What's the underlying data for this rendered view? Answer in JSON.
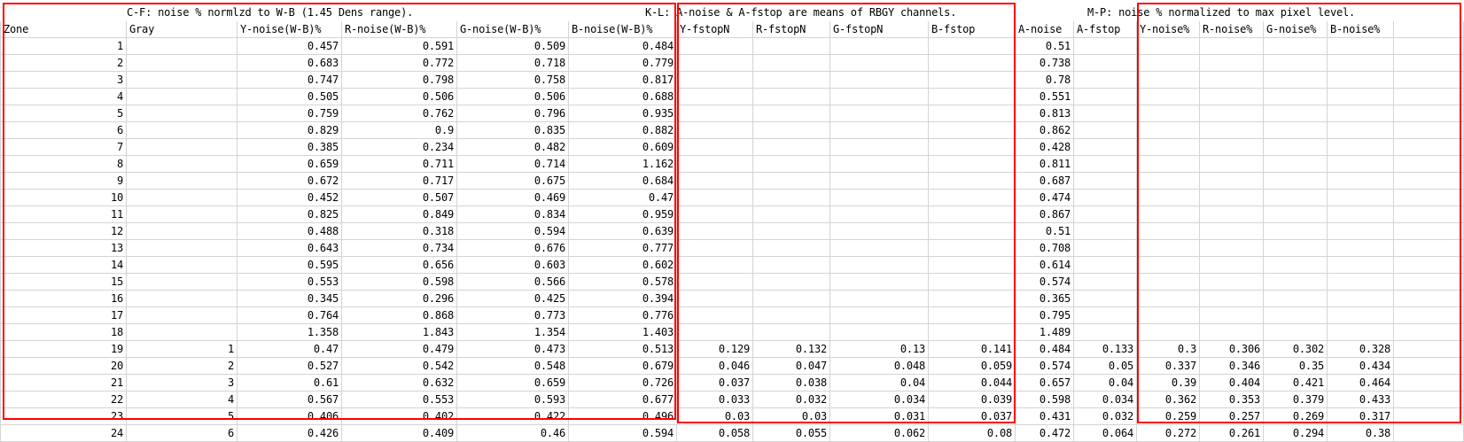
{
  "notes": {
    "c_f": "C-F: noise % normlzd to W-B (1.45 Dens range).",
    "k_l": "K-L: A-noise & A-fstop are means of RBGY channels.",
    "m_p": "M-P: noise % normalized to max pixel level."
  },
  "headers": [
    "Zone",
    "Gray",
    "Y-noise(W-B)%",
    "R-noise(W-B)%",
    "G-noise(W-B)%",
    "B-noise(W-B)%",
    "Y-fstopN",
    "R-fstopN",
    "G-fstopN",
    "B-fstop",
    "A-noise",
    "A-fstop",
    "Y-noise%",
    "R-noise%",
    "G-noise%",
    "B-noise%",
    ""
  ],
  "rows": [
    [
      "1",
      "",
      "0.457",
      "0.591",
      "0.509",
      "0.484",
      "",
      "",
      "",
      "",
      "0.51",
      "",
      "",
      "",
      "",
      "",
      ""
    ],
    [
      "2",
      "",
      "0.683",
      "0.772",
      "0.718",
      "0.779",
      "",
      "",
      "",
      "",
      "0.738",
      "",
      "",
      "",
      "",
      "",
      ""
    ],
    [
      "3",
      "",
      "0.747",
      "0.798",
      "0.758",
      "0.817",
      "",
      "",
      "",
      "",
      "0.78",
      "",
      "",
      "",
      "",
      "",
      ""
    ],
    [
      "4",
      "",
      "0.505",
      "0.506",
      "0.506",
      "0.688",
      "",
      "",
      "",
      "",
      "0.551",
      "",
      "",
      "",
      "",
      "",
      ""
    ],
    [
      "5",
      "",
      "0.759",
      "0.762",
      "0.796",
      "0.935",
      "",
      "",
      "",
      "",
      "0.813",
      "",
      "",
      "",
      "",
      "",
      ""
    ],
    [
      "6",
      "",
      "0.829",
      "0.9",
      "0.835",
      "0.882",
      "",
      "",
      "",
      "",
      "0.862",
      "",
      "",
      "",
      "",
      "",
      ""
    ],
    [
      "7",
      "",
      "0.385",
      "0.234",
      "0.482",
      "0.609",
      "",
      "",
      "",
      "",
      "0.428",
      "",
      "",
      "",
      "",
      "",
      ""
    ],
    [
      "8",
      "",
      "0.659",
      "0.711",
      "0.714",
      "1.162",
      "",
      "",
      "",
      "",
      "0.811",
      "",
      "",
      "",
      "",
      "",
      ""
    ],
    [
      "9",
      "",
      "0.672",
      "0.717",
      "0.675",
      "0.684",
      "",
      "",
      "",
      "",
      "0.687",
      "",
      "",
      "",
      "",
      "",
      ""
    ],
    [
      "10",
      "",
      "0.452",
      "0.507",
      "0.469",
      "0.47",
      "",
      "",
      "",
      "",
      "0.474",
      "",
      "",
      "",
      "",
      "",
      ""
    ],
    [
      "11",
      "",
      "0.825",
      "0.849",
      "0.834",
      "0.959",
      "",
      "",
      "",
      "",
      "0.867",
      "",
      "",
      "",
      "",
      "",
      ""
    ],
    [
      "12",
      "",
      "0.488",
      "0.318",
      "0.594",
      "0.639",
      "",
      "",
      "",
      "",
      "0.51",
      "",
      "",
      "",
      "",
      "",
      ""
    ],
    [
      "13",
      "",
      "0.643",
      "0.734",
      "0.676",
      "0.777",
      "",
      "",
      "",
      "",
      "0.708",
      "",
      "",
      "",
      "",
      "",
      ""
    ],
    [
      "14",
      "",
      "0.595",
      "0.656",
      "0.603",
      "0.602",
      "",
      "",
      "",
      "",
      "0.614",
      "",
      "",
      "",
      "",
      "",
      ""
    ],
    [
      "15",
      "",
      "0.553",
      "0.598",
      "0.566",
      "0.578",
      "",
      "",
      "",
      "",
      "0.574",
      "",
      "",
      "",
      "",
      "",
      ""
    ],
    [
      "16",
      "",
      "0.345",
      "0.296",
      "0.425",
      "0.394",
      "",
      "",
      "",
      "",
      "0.365",
      "",
      "",
      "",
      "",
      "",
      ""
    ],
    [
      "17",
      "",
      "0.764",
      "0.868",
      "0.773",
      "0.776",
      "",
      "",
      "",
      "",
      "0.795",
      "",
      "",
      "",
      "",
      "",
      ""
    ],
    [
      "18",
      "",
      "1.358",
      "1.843",
      "1.354",
      "1.403",
      "",
      "",
      "",
      "",
      "1.489",
      "",
      "",
      "",
      "",
      "",
      ""
    ],
    [
      "19",
      "1",
      "0.47",
      "0.479",
      "0.473",
      "0.513",
      "0.129",
      "0.132",
      "0.13",
      "0.141",
      "0.484",
      "0.133",
      "0.3",
      "0.306",
      "0.302",
      "0.328",
      ""
    ],
    [
      "20",
      "2",
      "0.527",
      "0.542",
      "0.548",
      "0.679",
      "0.046",
      "0.047",
      "0.048",
      "0.059",
      "0.574",
      "0.05",
      "0.337",
      "0.346",
      "0.35",
      "0.434",
      ""
    ],
    [
      "21",
      "3",
      "0.61",
      "0.632",
      "0.659",
      "0.726",
      "0.037",
      "0.038",
      "0.04",
      "0.044",
      "0.657",
      "0.04",
      "0.39",
      "0.404",
      "0.421",
      "0.464",
      ""
    ],
    [
      "22",
      "4",
      "0.567",
      "0.553",
      "0.593",
      "0.677",
      "0.033",
      "0.032",
      "0.034",
      "0.039",
      "0.598",
      "0.034",
      "0.362",
      "0.353",
      "0.379",
      "0.433",
      ""
    ],
    [
      "23",
      "5",
      "0.406",
      "0.402",
      "0.422",
      "0.496",
      "0.03",
      "0.03",
      "0.031",
      "0.037",
      "0.431",
      "0.032",
      "0.259",
      "0.257",
      "0.269",
      "0.317",
      ""
    ],
    [
      "24",
      "6",
      "0.426",
      "0.409",
      "0.46",
      "0.594",
      "0.058",
      "0.055",
      "0.062",
      "0.08",
      "0.472",
      "0.064",
      "0.272",
      "0.261",
      "0.294",
      "0.38",
      ""
    ]
  ],
  "colors": {
    "highlight_border": "#ff0000",
    "gridline": "#d4d4d4"
  }
}
